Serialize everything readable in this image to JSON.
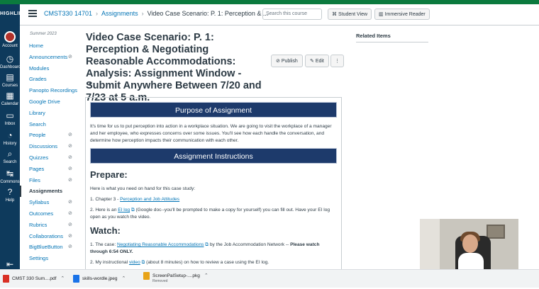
{
  "global_nav": {
    "logo_text": "HIGHLINE COLLEGE",
    "items": [
      {
        "label": "Account",
        "icon": "account-avatar-icon"
      },
      {
        "label": "Dashboard",
        "icon": "dashboard-icon"
      },
      {
        "label": "Courses",
        "icon": "courses-icon"
      },
      {
        "label": "Calendar",
        "icon": "calendar-icon"
      },
      {
        "label": "Inbox",
        "icon": "inbox-icon"
      },
      {
        "label": "History",
        "icon": "history-icon"
      },
      {
        "label": "Search",
        "icon": "search-icon"
      },
      {
        "label": "Commons",
        "icon": "commons-icon"
      },
      {
        "label": "Help",
        "icon": "help-icon"
      }
    ],
    "inbox_badge": "",
    "help_badge": ""
  },
  "breadcrumb": {
    "course": "CMST330 14701",
    "section": "Assignments",
    "current": "Video Case Scenario: P. 1: Perception & ..."
  },
  "header": {
    "search_placeholder": "Search this course",
    "student_view_label": "Student View",
    "immersive_reader_label": "Immersive Reader"
  },
  "course_nav": {
    "term": "Summer 2023",
    "items": [
      {
        "label": "Home",
        "hidden": false
      },
      {
        "label": "Announcements",
        "hidden": true
      },
      {
        "label": "Modules",
        "hidden": false
      },
      {
        "label": "Grades",
        "hidden": false
      },
      {
        "label": "Panopto Recordings",
        "hidden": false
      },
      {
        "label": "Google Drive",
        "hidden": false
      },
      {
        "label": "Library",
        "hidden": false
      },
      {
        "label": "Search",
        "hidden": false
      },
      {
        "label": "People",
        "hidden": true
      },
      {
        "label": "Discussions",
        "hidden": true
      },
      {
        "label": "Quizzes",
        "hidden": true
      },
      {
        "label": "Pages",
        "hidden": true
      },
      {
        "label": "Files",
        "hidden": true
      },
      {
        "label": "Assignments",
        "hidden": false,
        "active": true
      },
      {
        "label": "Syllabus",
        "hidden": true
      },
      {
        "label": "Outcomes",
        "hidden": true
      },
      {
        "label": "Rubrics",
        "hidden": true
      },
      {
        "label": "Collaborations",
        "hidden": true
      },
      {
        "label": "BigBlueButton",
        "hidden": true
      },
      {
        "label": "Settings",
        "hidden": false
      }
    ]
  },
  "assignment": {
    "title": "Video Case Scenario: P. 1: Perception & Negotiating Reasonable Accommodations: Analysis: Assignment Window - Submit Anywhere Between 7/20 and 7/23 at 5 a.m.",
    "publish_label": "Publish",
    "edit_label": "Edit",
    "more_label": "⋮"
  },
  "content": {
    "banner_purpose": "Purpose of Assignment",
    "purpose_text": "It's time for us to put perception into action in a workplace situation. We are going to visit the workplace of a manager and her employee, who expresses concerns over some issues. You'll see how each handle the conversation, and determine how perception impacts their communication with each other.",
    "banner_instructions": "Assignment Instructions",
    "prepare_heading": "Prepare:",
    "prepare_intro": "Here is what you need on hand for this case study:",
    "item1_prefix": "1. Chapter 3 - ",
    "item1_link": "Perception and Job Attitudes",
    "item2_prefix": "2. Here is an ",
    "item2_link": "EI log",
    "item2_suffix": " (Google doc--you'll be prompted to make a copy for yourself) you can fill out. Have your EI log open as you watch the video.",
    "watch_heading": "Watch:",
    "watch1_prefix": "1. The case: ",
    "watch1_link": "Negotiating Reasonable Accommodations",
    "watch1_mid": " by the Job Accommodation Network -- ",
    "watch1_bold": "Please watch through 6:54 ONLY.",
    "watch2_prefix": "2. My instructional ",
    "watch2_link": "video",
    "watch2_suffix": " (about 8 minutes) on how to review a case using the EI log."
  },
  "sidebar": {
    "related_items": "Related Items"
  },
  "downloads": [
    {
      "name": "CMST 330 Sum....pdf",
      "icon_color": "#d93025",
      "status": ""
    },
    {
      "name": "skills-wordle.jpeg",
      "icon_color": "#1a73e8",
      "status": ""
    },
    {
      "name": "ScreenPalSetup-....pkg",
      "icon_color": "#e8a317",
      "status": "Removed"
    }
  ],
  "colors": {
    "global_nav_bg": "#0e3a5c",
    "link": "#0374b5",
    "banner_bg": "#1d3a6b"
  }
}
